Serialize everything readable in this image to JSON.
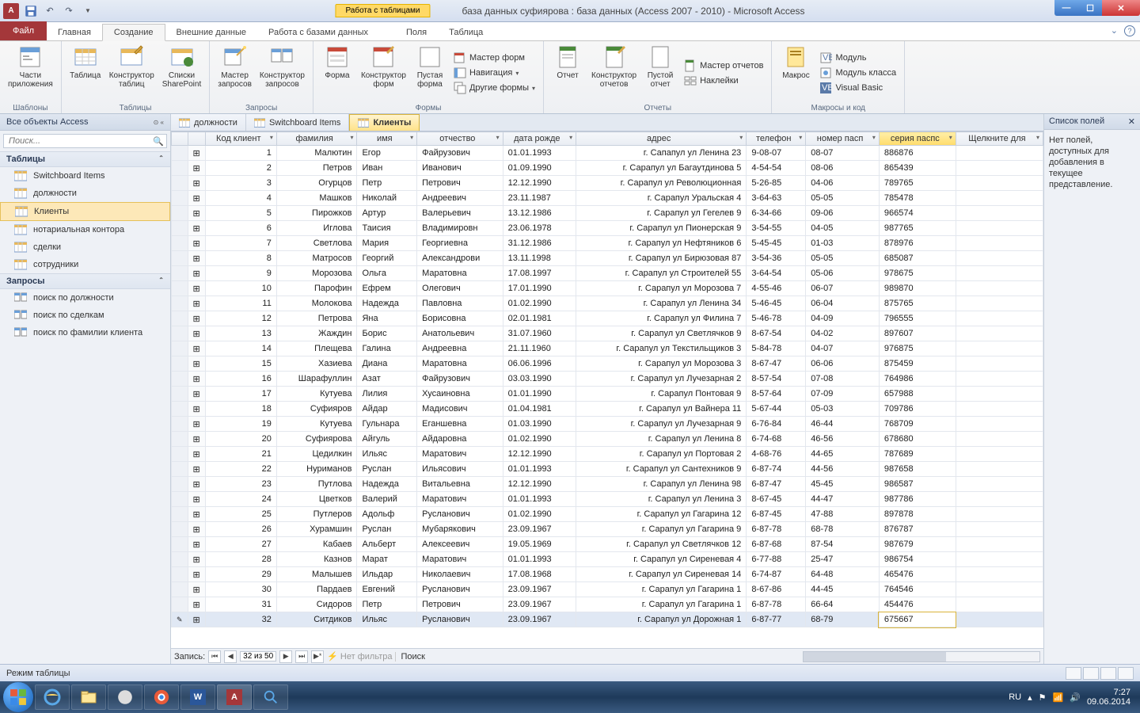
{
  "titlebar": {
    "tools_label": "Работа с таблицами",
    "title": "база данных суфиярова : база данных (Access 2007 - 2010)  -  Microsoft Access"
  },
  "ribbon_tabs": {
    "file": "Файл",
    "home": "Главная",
    "create": "Создание",
    "external": "Внешние данные",
    "dbtools": "Работа с базами данных",
    "fields": "Поля",
    "table": "Таблица"
  },
  "ribbon": {
    "templates": {
      "label": "Шаблоны",
      "app_parts": "Части\nприложения"
    },
    "tables": {
      "label": "Таблицы",
      "table": "Таблица",
      "designer": "Конструктор\nтаблиц",
      "sp": "Списки\nSharePoint"
    },
    "queries": {
      "label": "Запросы",
      "wizard": "Мастер\nзапросов",
      "designer": "Конструктор\nзапросов"
    },
    "forms": {
      "label": "Формы",
      "form": "Форма",
      "designer": "Конструктор\nформ",
      "blank": "Пустая\nформа",
      "wizard": "Мастер форм",
      "nav": "Навигация",
      "other": "Другие формы"
    },
    "reports": {
      "label": "Отчеты",
      "report": "Отчет",
      "designer": "Конструктор\nотчетов",
      "blank": "Пустой\nотчет",
      "wizard": "Мастер отчетов",
      "labels": "Наклейки"
    },
    "macros": {
      "label": "Макросы и код",
      "macro": "Макрос",
      "module": "Модуль",
      "class": "Модуль класса",
      "vb": "Visual Basic"
    }
  },
  "nav": {
    "header": "Все объекты Access",
    "search_ph": "Поиск...",
    "cat_tables": "Таблицы",
    "cat_queries": "Запросы",
    "tables": [
      "Switchboard Items",
      "должности",
      "Клиенты",
      "нотариальная контора",
      "сделки",
      "сотрудники"
    ],
    "queries": [
      "поиск по должности",
      "поиск по сделкам",
      "поиск по фамилии клиента"
    ]
  },
  "doc_tabs": [
    "должности",
    "Switchboard Items",
    "Клиенты"
  ],
  "columns": [
    "Код клиент",
    "фамилия",
    "имя",
    "отчество",
    "дата рожде",
    "адрес",
    "телефон",
    "номер пасп",
    "серия паспс",
    "Щелкните для"
  ],
  "rows": [
    [
      1,
      "Малютин",
      "Егор",
      "Файрузович",
      "01.01.1993",
      "г. Сапапул ул Ленина 23",
      "9-08-07",
      "08-07",
      "886876"
    ],
    [
      2,
      "Петров",
      "Иван",
      "Иванович",
      "01.09.1990",
      "г. Сарапул ул Багаутдинова 5",
      "4-54-54",
      "08-06",
      "865439"
    ],
    [
      3,
      "Огурцов",
      "Петр",
      "Петрович",
      "12.12.1990",
      "г. Сарапул ул Революционная",
      "5-26-85",
      "04-06",
      "789765"
    ],
    [
      4,
      "Машков",
      "Николай",
      "Андреевич",
      "23.11.1987",
      "г. Сарапул Уральская 4",
      "3-64-63",
      "05-05",
      "785478"
    ],
    [
      5,
      "Пирожков",
      "Артур",
      "Валерьевич",
      "13.12.1986",
      "г. Сарапул ул Гегелев 9",
      "6-34-66",
      "09-06",
      "966574"
    ],
    [
      6,
      "Иглова",
      "Таисия",
      "Владимировн",
      "23.06.1978",
      "г. Сарапул ул Пионерская 9",
      "3-54-55",
      "04-05",
      "987765"
    ],
    [
      7,
      "Светлова",
      "Мария",
      "Георгиевна",
      "31.12.1986",
      "г. Сарапул ул Нефтяников 6",
      "5-45-45",
      "01-03",
      "878976"
    ],
    [
      8,
      "Матросов",
      "Георгий",
      "Александрови",
      "13.11.1998",
      "г. Сарапул ул Бирюзовая 87",
      "3-54-36",
      "05-05",
      "685087"
    ],
    [
      9,
      "Морозова",
      "Ольга",
      "Маратовна",
      "17.08.1997",
      "г. Сарапул ул Строителей 55",
      "3-64-54",
      "05-06",
      "978675"
    ],
    [
      10,
      "Парофин",
      "Ефрем",
      "Олегович",
      "17.01.1990",
      "г. Сарапул ул Морозова 7",
      "4-55-46",
      "06-07",
      "989870"
    ],
    [
      11,
      "Молокова",
      "Надежда",
      "Павловна",
      "01.02.1990",
      "г. Сарапул ул Ленина 34",
      "5-46-45",
      "06-04",
      "875765"
    ],
    [
      12,
      "Петрова",
      "Яна",
      "Борисовна",
      "02.01.1981",
      "г. Сарапул ул Филина 7",
      "5-46-78",
      "04-09",
      "796555"
    ],
    [
      13,
      "Жаждин",
      "Борис",
      "Анатольевич",
      "31.07.1960",
      "г. Сарапул ул Светлячков 9",
      "8-67-54",
      "04-02",
      "897607"
    ],
    [
      14,
      "Плещева",
      "Галина",
      "Андреевна",
      "21.11.1960",
      "г. Сарапул ул Текстильщиков 3",
      "5-84-78",
      "04-07",
      "976875"
    ],
    [
      15,
      "Хазиева",
      "Диана",
      "Маратовна",
      "06.06.1996",
      "г. Сарапул ул Морозова 3",
      "8-67-47",
      "06-06",
      "875459"
    ],
    [
      16,
      "Шарафуллин",
      "Азат",
      "Файрузович",
      "03.03.1990",
      "г. Сарапул ул Лучезарная 2",
      "8-57-54",
      "07-08",
      "764986"
    ],
    [
      17,
      "Кутуева",
      "Лилия",
      "Хусаиновна",
      "01.01.1990",
      "г. Сарапул Понтовая 9",
      "8-57-64",
      "07-09",
      "657988"
    ],
    [
      18,
      "Суфияров",
      "Айдар",
      "Мадисович",
      "01.04.1981",
      "г. Сарапул ул Вайнера 11",
      "5-67-44",
      "05-03",
      "709786"
    ],
    [
      19,
      "Кутуева",
      "Гульнара",
      "Еганшевна",
      "01.03.1990",
      "г. Сарапул ул Лучезарная 9",
      "6-76-84",
      "46-44",
      "768709"
    ],
    [
      20,
      "Суфиярова",
      "Айгуль",
      "Айдаровна",
      "01.02.1990",
      "г. Сарапул ул Ленина 8",
      "6-74-68",
      "46-56",
      "678680"
    ],
    [
      21,
      "Цедилкин",
      "Ильяс",
      "Маратович",
      "12.12.1990",
      "г. Сарапул ул Портовая 2",
      "4-68-76",
      "44-65",
      "787689"
    ],
    [
      22,
      "Нуриманов",
      "Руслан",
      "Ильясович",
      "01.01.1993",
      "г. Сарапул ул Сантехников 9",
      "6-87-74",
      "44-56",
      "987658"
    ],
    [
      23,
      "Путлова",
      "Надежда",
      "Витальевна",
      "12.12.1990",
      "г. Сарапул ул Ленина 98",
      "6-87-47",
      "45-45",
      "986587"
    ],
    [
      24,
      "Цветков",
      "Валерий",
      "Маратович",
      "01.01.1993",
      "г. Сарапул ул Ленина 3",
      "8-67-45",
      "44-47",
      "987786"
    ],
    [
      25,
      "Путлеров",
      "Адольф",
      "Русланович",
      "01.02.1990",
      "г. Сарапул ул Гагарина 12",
      "6-87-45",
      "47-88",
      "897878"
    ],
    [
      26,
      "Хурамшин",
      "Руслан",
      "Мубарякович",
      "23.09.1967",
      "г. Сарапул ул Гагарина 9",
      "6-87-78",
      "68-78",
      "876787"
    ],
    [
      27,
      "Кабаев",
      "Альберт",
      "Алексеевич",
      "19.05.1969",
      "г. Сарапул ул Светлячков 12",
      "6-87-68",
      "87-54",
      "987679"
    ],
    [
      28,
      "Казнов",
      "Марат",
      "Маратович",
      "01.01.1993",
      "г. Сарапул ул Сиреневая 4",
      "6-77-88",
      "25-47",
      "986754"
    ],
    [
      29,
      "Малышев",
      "Ильдар",
      "Николаевич",
      "17.08.1968",
      "г. Сарапул ул Сиреневая 14",
      "6-74-87",
      "64-48",
      "465476"
    ],
    [
      30,
      "Пардаев",
      "Евгений",
      "Русланович",
      "23.09.1967",
      "г. Сарапул ул Гагарина 1",
      "8-67-86",
      "44-45",
      "764546"
    ],
    [
      31,
      "Сидоров",
      "Петр",
      "Петрович",
      "23.09.1967",
      "г. Сарапул ул Гагарина 1",
      "6-87-78",
      "66-64",
      "454476"
    ],
    [
      32,
      "Ситдиков",
      "Ильяс",
      "Русланович",
      "23.09.1967",
      "г. Сарапул ул Дорожная 1",
      "6-87-77",
      "68-79",
      "675667"
    ]
  ],
  "recnav": {
    "label": "Запись:",
    "pos": "32 из 50",
    "filter": "Нет фильтра",
    "search": "Поиск"
  },
  "fieldpane": {
    "title": "Список полей",
    "body": "Нет полей, доступных для добавления в текущее представление."
  },
  "statusbar": {
    "mode": "Режим таблицы"
  },
  "tray": {
    "lang": "RU",
    "time": "7:27",
    "date": "09.06.2014"
  }
}
